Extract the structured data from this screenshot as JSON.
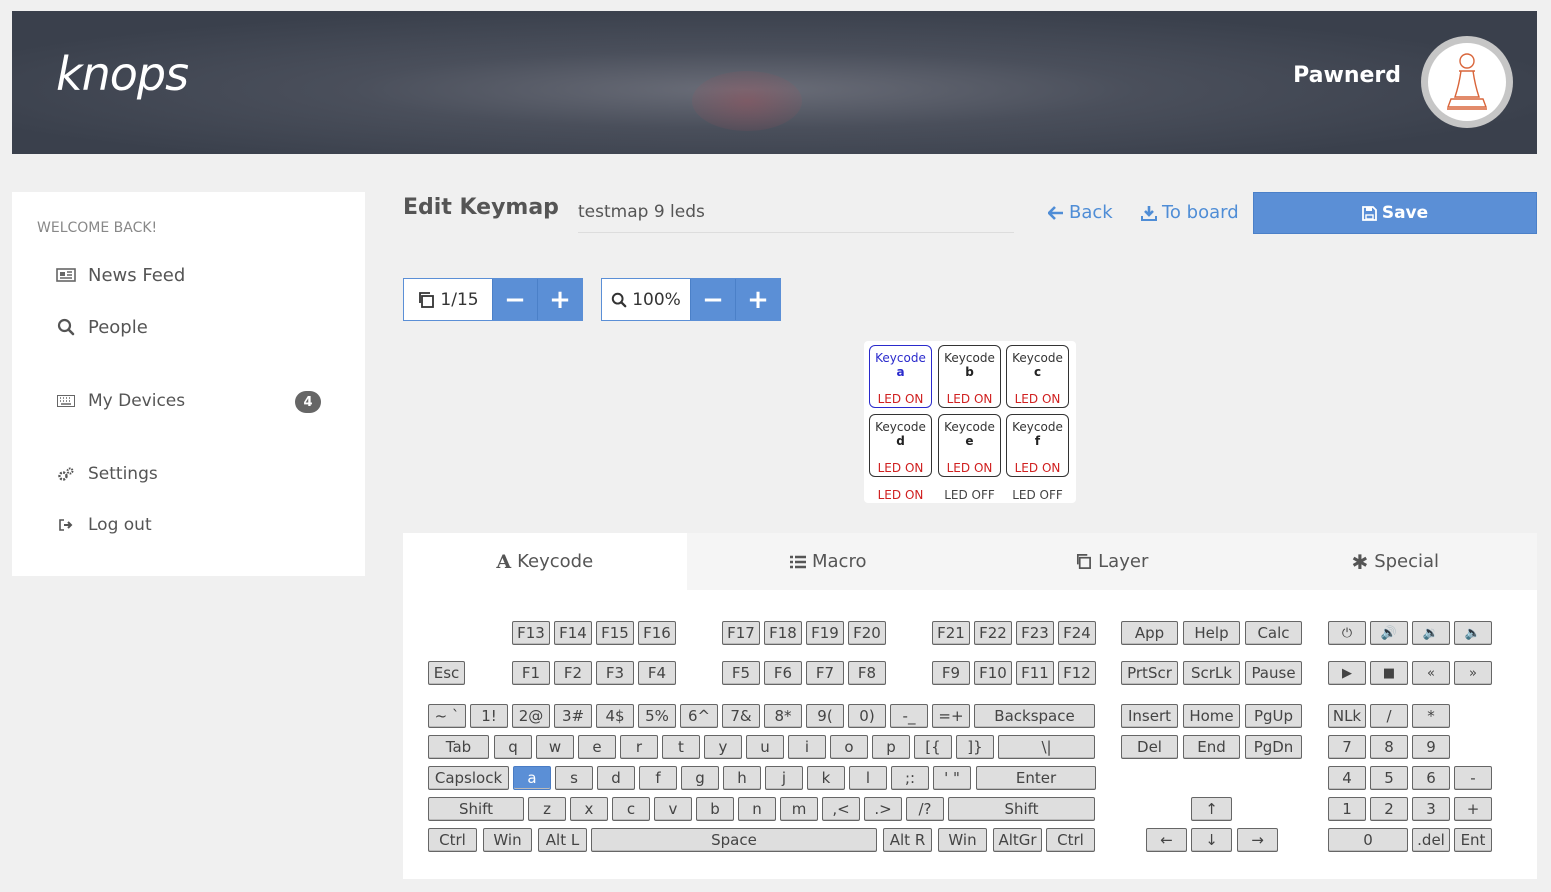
{
  "header": {
    "logo": "knops",
    "username": "Pawnerd"
  },
  "sidebar": {
    "welcome": "WELCOME BACK!",
    "items": [
      {
        "label": "News Feed",
        "icon": "newspaper-icon"
      },
      {
        "label": "People",
        "icon": "search-icon"
      },
      {
        "label": "My Devices",
        "icon": "keyboard-icon",
        "badge": "4"
      },
      {
        "label": "Settings",
        "icon": "gears-icon"
      },
      {
        "label": "Log out",
        "icon": "sign-out-icon"
      }
    ]
  },
  "toolbar": {
    "title": "Edit Keymap",
    "keymap_name": "testmap 9 leds",
    "back_label": "Back",
    "to_board_label": "To board",
    "save_label": "Save",
    "layer_value": "1/15",
    "zoom_value": "100%",
    "minus": "−",
    "plus": "+"
  },
  "keymap_grid": {
    "keys": [
      {
        "keycode": "Keycode",
        "value": "a",
        "led": "LED ON",
        "selected": true
      },
      {
        "keycode": "Keycode",
        "value": "b",
        "led": "LED ON"
      },
      {
        "keycode": "Keycode",
        "value": "c",
        "led": "LED ON"
      },
      {
        "keycode": "Keycode",
        "value": "d",
        "led": "LED ON"
      },
      {
        "keycode": "Keycode",
        "value": "e",
        "led": "LED ON"
      },
      {
        "keycode": "Keycode",
        "value": "f",
        "led": "LED ON"
      }
    ],
    "extra_leds": [
      "LED ON",
      "LED OFF",
      "LED OFF"
    ]
  },
  "tabs": [
    {
      "label": "Keycode",
      "icon": "font-icon",
      "active": true
    },
    {
      "label": "Macro",
      "icon": "list-icon"
    },
    {
      "label": "Layer",
      "icon": "copy-icon"
    },
    {
      "label": "Special",
      "icon": "asterisk-icon"
    }
  ],
  "keyboard": {
    "fkeys_top": [
      "F13",
      "F14",
      "F15",
      "F16",
      "F17",
      "F18",
      "F19",
      "F20",
      "F21",
      "F22",
      "F23",
      "F24"
    ],
    "fkeys": [
      "Esc",
      "F1",
      "F2",
      "F3",
      "F4",
      "F5",
      "F6",
      "F7",
      "F8",
      "F9",
      "F10",
      "F11",
      "F12"
    ],
    "row1": [
      "~ `",
      "1!",
      "2@",
      "3#",
      "4$",
      "5%",
      "6^",
      "7&",
      "8*",
      "9(",
      "0)",
      "-_",
      "=+",
      "Backspace"
    ],
    "row2": [
      "Tab",
      "q",
      "w",
      "e",
      "r",
      "t",
      "y",
      "u",
      "i",
      "o",
      "p",
      "[{",
      "]}",
      "\\|"
    ],
    "row3": [
      "Capslock",
      "a",
      "s",
      "d",
      "f",
      "g",
      "h",
      "j",
      "k",
      "l",
      ";:",
      "' \"",
      "Enter"
    ],
    "row4": [
      "Shift",
      "z",
      "x",
      "c",
      "v",
      "b",
      "n",
      "m",
      ",<",
      ".>",
      "/?",
      "Shift"
    ],
    "row5": [
      "Ctrl",
      "Win",
      "Alt L",
      "Space",
      "Alt R",
      "Win",
      "AltGr",
      "Ctrl"
    ],
    "app_keys": [
      "App",
      "Help",
      "Calc",
      "PrtScr",
      "ScrLk",
      "Pause"
    ],
    "nav_keys": [
      "Insert",
      "Home",
      "PgUp",
      "Del",
      "End",
      "PgDn"
    ],
    "arrows": [
      "↑",
      "←",
      "↓",
      "→"
    ],
    "media": [
      "⏻",
      "🔊",
      "🔉",
      "🔈",
      "▶",
      "■",
      "«",
      "»"
    ],
    "numpad": [
      "NLk",
      "/",
      "*",
      "7",
      "8",
      "9",
      "4",
      "5",
      "6",
      "-",
      "1",
      "2",
      "3",
      "+",
      "0",
      ".del",
      "Ent"
    ],
    "selected_key": "a"
  }
}
